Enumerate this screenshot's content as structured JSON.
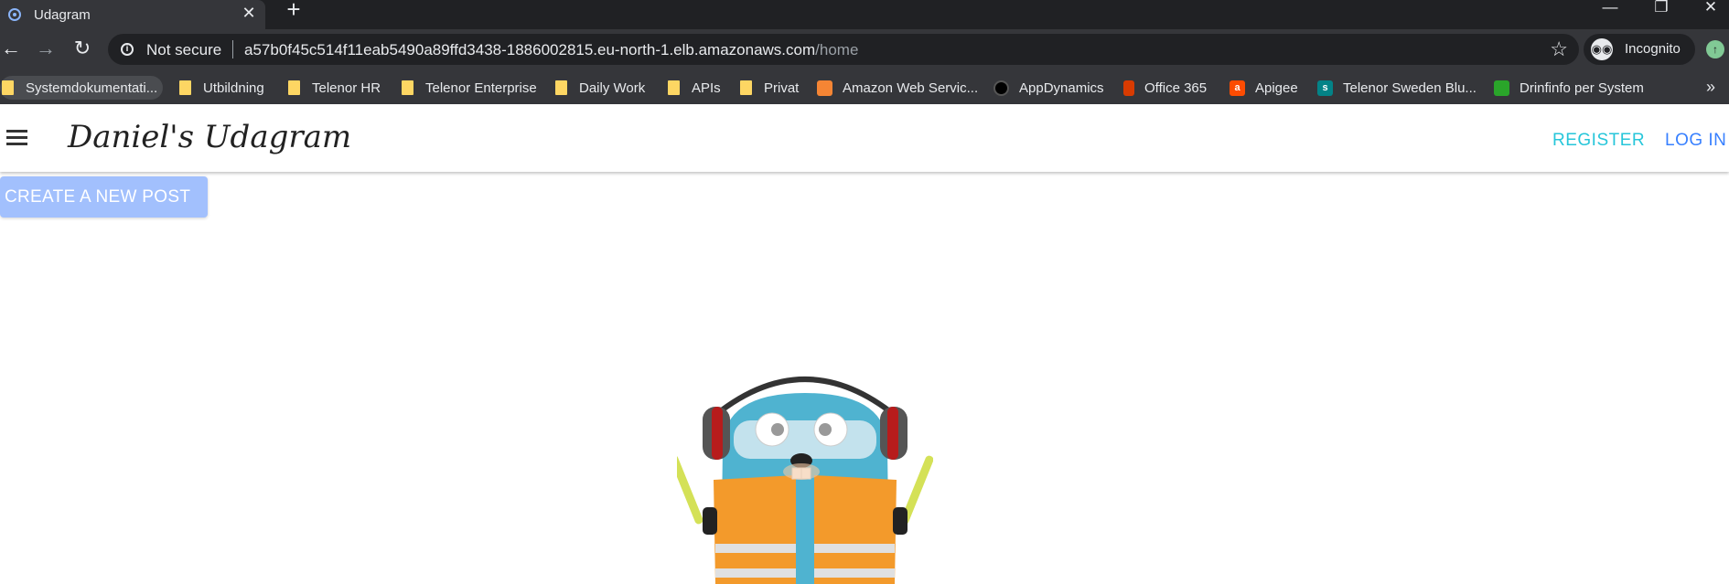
{
  "browser": {
    "tab": {
      "title": "Udagram",
      "favicon": "udagram-icon"
    },
    "toolbar": {
      "security_label": "Not secure",
      "url_host": "a57b0f45c514f11eab5490a89ffd3438-1886002815.eu-north-1.elb.amazonaws.com",
      "url_path": "/home",
      "incognito_label": "Incognito"
    },
    "bookmarks": [
      {
        "label": "Systemdokumentati...",
        "icon": "folder-icon"
      },
      {
        "label": "Utbildning",
        "icon": "folder-icon"
      },
      {
        "label": "Telenor HR",
        "icon": "folder-icon"
      },
      {
        "label": "Telenor Enterprise",
        "icon": "folder-icon"
      },
      {
        "label": "Daily Work",
        "icon": "folder-icon"
      },
      {
        "label": "APIs",
        "icon": "folder-icon"
      },
      {
        "label": "Privat",
        "icon": "folder-icon"
      },
      {
        "label": "Amazon Web Servic...",
        "icon": "aws-icon"
      },
      {
        "label": "AppDynamics",
        "icon": "appdynamics-icon"
      },
      {
        "label": "Office 365",
        "icon": "office-icon"
      },
      {
        "label": "Apigee",
        "icon": "apigee-icon"
      },
      {
        "label": "Telenor Sweden Blu...",
        "icon": "sharepoint-icon"
      },
      {
        "label": "Drinfinfo per System",
        "icon": "drinfinfo-icon"
      }
    ]
  },
  "app": {
    "brand": "Daniel's Udagram",
    "nav": {
      "register": "REGISTER",
      "login": "LOG IN"
    },
    "create_button": "CREATE A NEW POST",
    "image": "gopher-mascot-image"
  },
  "colors": {
    "register": "#26c6da",
    "login": "#3880ff",
    "create_button_bg": "#a2c0fd"
  }
}
